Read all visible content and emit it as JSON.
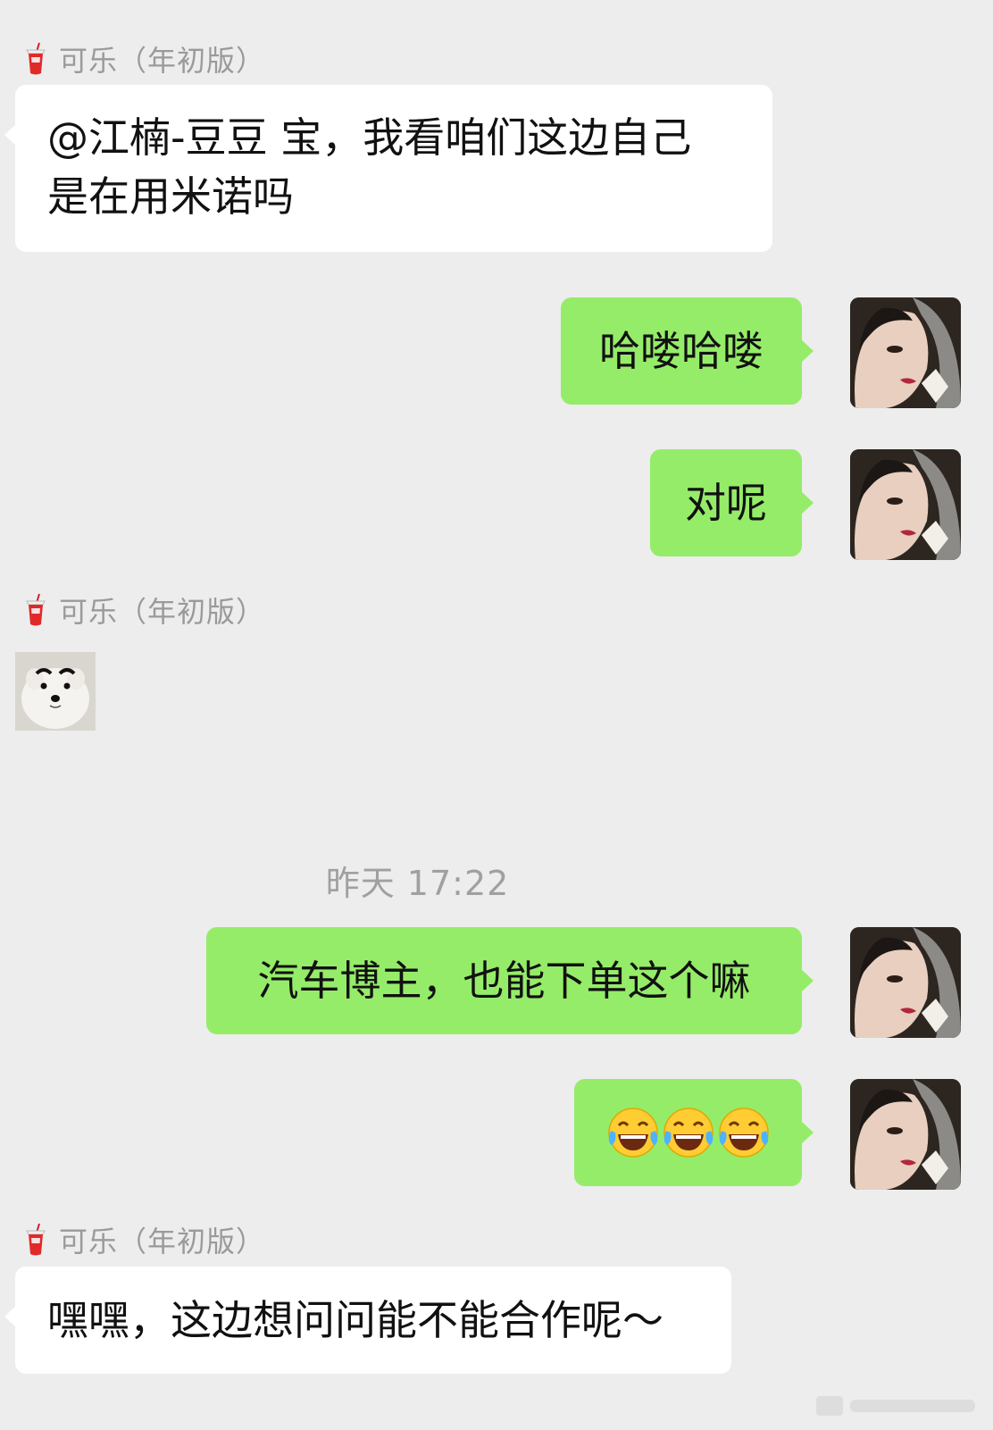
{
  "messages": [
    {
      "kind": "sender",
      "name": "可乐（年初版）"
    },
    {
      "kind": "incoming",
      "text": "@江楠-豆豆 宝，我看咱们这边自己\n是在用米诺吗"
    },
    {
      "kind": "outgoing",
      "text": "哈喽哈喽"
    },
    {
      "kind": "outgoing",
      "text": "对呢"
    },
    {
      "kind": "sender",
      "name": "可乐（年初版）"
    },
    {
      "kind": "sticker",
      "icon": "samoyed-sticker"
    },
    {
      "kind": "timestamp",
      "text": "昨天 17:22"
    },
    {
      "kind": "outgoing",
      "text": "汽车博主，也能下单这个嘛"
    },
    {
      "kind": "outgoing",
      "emoji": "tears-of-joy",
      "count": 3
    },
    {
      "kind": "sender",
      "name": "可乐（年初版）"
    },
    {
      "kind": "incoming",
      "text": "嘿嘿，这边想问问能不能合作呢～"
    }
  ],
  "colors": {
    "background": "#ededed",
    "incoming_bubble": "#ffffff",
    "outgoing_bubble": "#95ec69",
    "muted_text": "#9a9a9a"
  },
  "icons": {
    "sender_avatar": "cola-cup-icon",
    "self_avatar": "user-photo-avatar"
  }
}
